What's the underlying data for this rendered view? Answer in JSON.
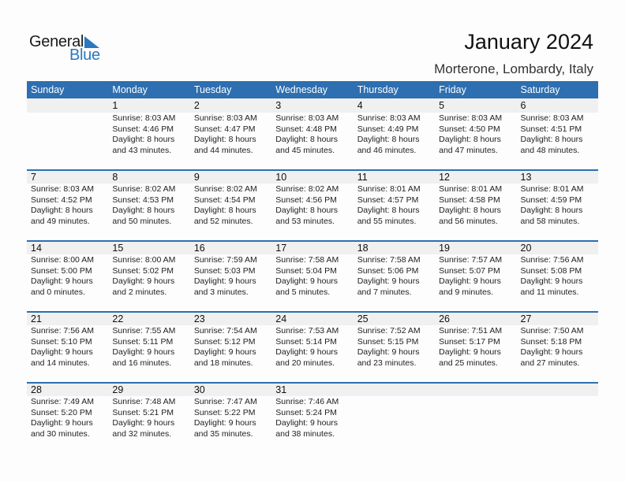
{
  "logo": {
    "word1": "General",
    "word2": "Blue"
  },
  "header": {
    "title": "January 2024",
    "location": "Morterone, Lombardy, Italy"
  },
  "colors": {
    "accent": "#2d6fb0",
    "logo_blue": "#2a78c2",
    "day_bar": "#f0f0f0"
  },
  "weekdays": [
    "Sunday",
    "Monday",
    "Tuesday",
    "Wednesday",
    "Thursday",
    "Friday",
    "Saturday"
  ],
  "weeks": [
    [
      null,
      {
        "day": "1",
        "sunrise": "Sunrise: 8:03 AM",
        "sunset": "Sunset: 4:46 PM",
        "daylight1": "Daylight: 8 hours",
        "daylight2": "and 43 minutes."
      },
      {
        "day": "2",
        "sunrise": "Sunrise: 8:03 AM",
        "sunset": "Sunset: 4:47 PM",
        "daylight1": "Daylight: 8 hours",
        "daylight2": "and 44 minutes."
      },
      {
        "day": "3",
        "sunrise": "Sunrise: 8:03 AM",
        "sunset": "Sunset: 4:48 PM",
        "daylight1": "Daylight: 8 hours",
        "daylight2": "and 45 minutes."
      },
      {
        "day": "4",
        "sunrise": "Sunrise: 8:03 AM",
        "sunset": "Sunset: 4:49 PM",
        "daylight1": "Daylight: 8 hours",
        "daylight2": "and 46 minutes."
      },
      {
        "day": "5",
        "sunrise": "Sunrise: 8:03 AM",
        "sunset": "Sunset: 4:50 PM",
        "daylight1": "Daylight: 8 hours",
        "daylight2": "and 47 minutes."
      },
      {
        "day": "6",
        "sunrise": "Sunrise: 8:03 AM",
        "sunset": "Sunset: 4:51 PM",
        "daylight1": "Daylight: 8 hours",
        "daylight2": "and 48 minutes."
      }
    ],
    [
      {
        "day": "7",
        "sunrise": "Sunrise: 8:03 AM",
        "sunset": "Sunset: 4:52 PM",
        "daylight1": "Daylight: 8 hours",
        "daylight2": "and 49 minutes."
      },
      {
        "day": "8",
        "sunrise": "Sunrise: 8:02 AM",
        "sunset": "Sunset: 4:53 PM",
        "daylight1": "Daylight: 8 hours",
        "daylight2": "and 50 minutes."
      },
      {
        "day": "9",
        "sunrise": "Sunrise: 8:02 AM",
        "sunset": "Sunset: 4:54 PM",
        "daylight1": "Daylight: 8 hours",
        "daylight2": "and 52 minutes."
      },
      {
        "day": "10",
        "sunrise": "Sunrise: 8:02 AM",
        "sunset": "Sunset: 4:56 PM",
        "daylight1": "Daylight: 8 hours",
        "daylight2": "and 53 minutes."
      },
      {
        "day": "11",
        "sunrise": "Sunrise: 8:01 AM",
        "sunset": "Sunset: 4:57 PM",
        "daylight1": "Daylight: 8 hours",
        "daylight2": "and 55 minutes."
      },
      {
        "day": "12",
        "sunrise": "Sunrise: 8:01 AM",
        "sunset": "Sunset: 4:58 PM",
        "daylight1": "Daylight: 8 hours",
        "daylight2": "and 56 minutes."
      },
      {
        "day": "13",
        "sunrise": "Sunrise: 8:01 AM",
        "sunset": "Sunset: 4:59 PM",
        "daylight1": "Daylight: 8 hours",
        "daylight2": "and 58 minutes."
      }
    ],
    [
      {
        "day": "14",
        "sunrise": "Sunrise: 8:00 AM",
        "sunset": "Sunset: 5:00 PM",
        "daylight1": "Daylight: 9 hours",
        "daylight2": "and 0 minutes."
      },
      {
        "day": "15",
        "sunrise": "Sunrise: 8:00 AM",
        "sunset": "Sunset: 5:02 PM",
        "daylight1": "Daylight: 9 hours",
        "daylight2": "and 2 minutes."
      },
      {
        "day": "16",
        "sunrise": "Sunrise: 7:59 AM",
        "sunset": "Sunset: 5:03 PM",
        "daylight1": "Daylight: 9 hours",
        "daylight2": "and 3 minutes."
      },
      {
        "day": "17",
        "sunrise": "Sunrise: 7:58 AM",
        "sunset": "Sunset: 5:04 PM",
        "daylight1": "Daylight: 9 hours",
        "daylight2": "and 5 minutes."
      },
      {
        "day": "18",
        "sunrise": "Sunrise: 7:58 AM",
        "sunset": "Sunset: 5:06 PM",
        "daylight1": "Daylight: 9 hours",
        "daylight2": "and 7 minutes."
      },
      {
        "day": "19",
        "sunrise": "Sunrise: 7:57 AM",
        "sunset": "Sunset: 5:07 PM",
        "daylight1": "Daylight: 9 hours",
        "daylight2": "and 9 minutes."
      },
      {
        "day": "20",
        "sunrise": "Sunrise: 7:56 AM",
        "sunset": "Sunset: 5:08 PM",
        "daylight1": "Daylight: 9 hours",
        "daylight2": "and 11 minutes."
      }
    ],
    [
      {
        "day": "21",
        "sunrise": "Sunrise: 7:56 AM",
        "sunset": "Sunset: 5:10 PM",
        "daylight1": "Daylight: 9 hours",
        "daylight2": "and 14 minutes."
      },
      {
        "day": "22",
        "sunrise": "Sunrise: 7:55 AM",
        "sunset": "Sunset: 5:11 PM",
        "daylight1": "Daylight: 9 hours",
        "daylight2": "and 16 minutes."
      },
      {
        "day": "23",
        "sunrise": "Sunrise: 7:54 AM",
        "sunset": "Sunset: 5:12 PM",
        "daylight1": "Daylight: 9 hours",
        "daylight2": "and 18 minutes."
      },
      {
        "day": "24",
        "sunrise": "Sunrise: 7:53 AM",
        "sunset": "Sunset: 5:14 PM",
        "daylight1": "Daylight: 9 hours",
        "daylight2": "and 20 minutes."
      },
      {
        "day": "25",
        "sunrise": "Sunrise: 7:52 AM",
        "sunset": "Sunset: 5:15 PM",
        "daylight1": "Daylight: 9 hours",
        "daylight2": "and 23 minutes."
      },
      {
        "day": "26",
        "sunrise": "Sunrise: 7:51 AM",
        "sunset": "Sunset: 5:17 PM",
        "daylight1": "Daylight: 9 hours",
        "daylight2": "and 25 minutes."
      },
      {
        "day": "27",
        "sunrise": "Sunrise: 7:50 AM",
        "sunset": "Sunset: 5:18 PM",
        "daylight1": "Daylight: 9 hours",
        "daylight2": "and 27 minutes."
      }
    ],
    [
      {
        "day": "28",
        "sunrise": "Sunrise: 7:49 AM",
        "sunset": "Sunset: 5:20 PM",
        "daylight1": "Daylight: 9 hours",
        "daylight2": "and 30 minutes."
      },
      {
        "day": "29",
        "sunrise": "Sunrise: 7:48 AM",
        "sunset": "Sunset: 5:21 PM",
        "daylight1": "Daylight: 9 hours",
        "daylight2": "and 32 minutes."
      },
      {
        "day": "30",
        "sunrise": "Sunrise: 7:47 AM",
        "sunset": "Sunset: 5:22 PM",
        "daylight1": "Daylight: 9 hours",
        "daylight2": "and 35 minutes."
      },
      {
        "day": "31",
        "sunrise": "Sunrise: 7:46 AM",
        "sunset": "Sunset: 5:24 PM",
        "daylight1": "Daylight: 9 hours",
        "daylight2": "and 38 minutes."
      },
      null,
      null,
      null
    ]
  ]
}
